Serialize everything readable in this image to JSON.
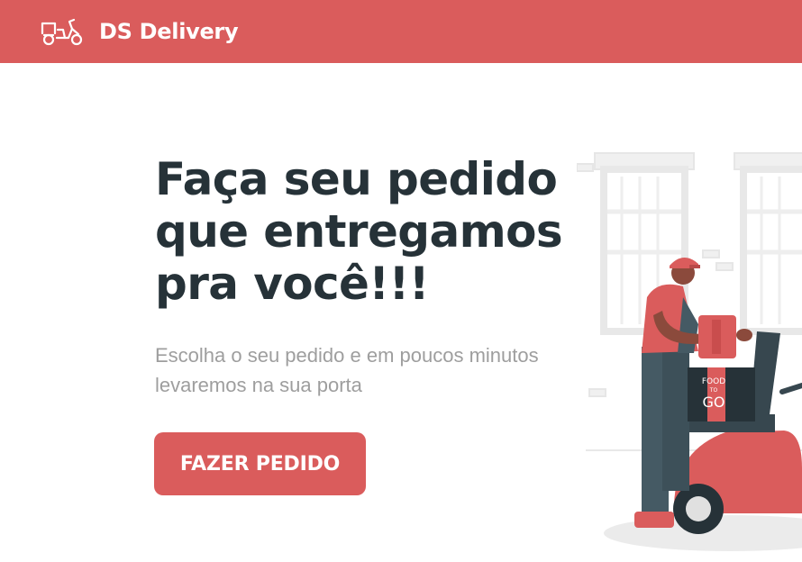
{
  "header": {
    "logo_icon": "scooter-icon",
    "brand": "DS Delivery"
  },
  "hero": {
    "title_lines": [
      "Faça seu pedido",
      "que entregamos",
      "pra você!!!"
    ],
    "subtitle_lines": [
      "Escolha o seu pedido e em poucos minutos",
      "levaremos na sua porta"
    ],
    "cta_label": "FAZER PEDIDO"
  },
  "illustration": {
    "icon": "delivery-man-scooter-illustration",
    "box_lines": [
      "FOOD",
      "TO",
      "GO"
    ]
  },
  "colors": {
    "primary": "#da5c5c",
    "heading": "#263238",
    "subtitle": "#9e9e9e",
    "background": "#ffffff"
  }
}
